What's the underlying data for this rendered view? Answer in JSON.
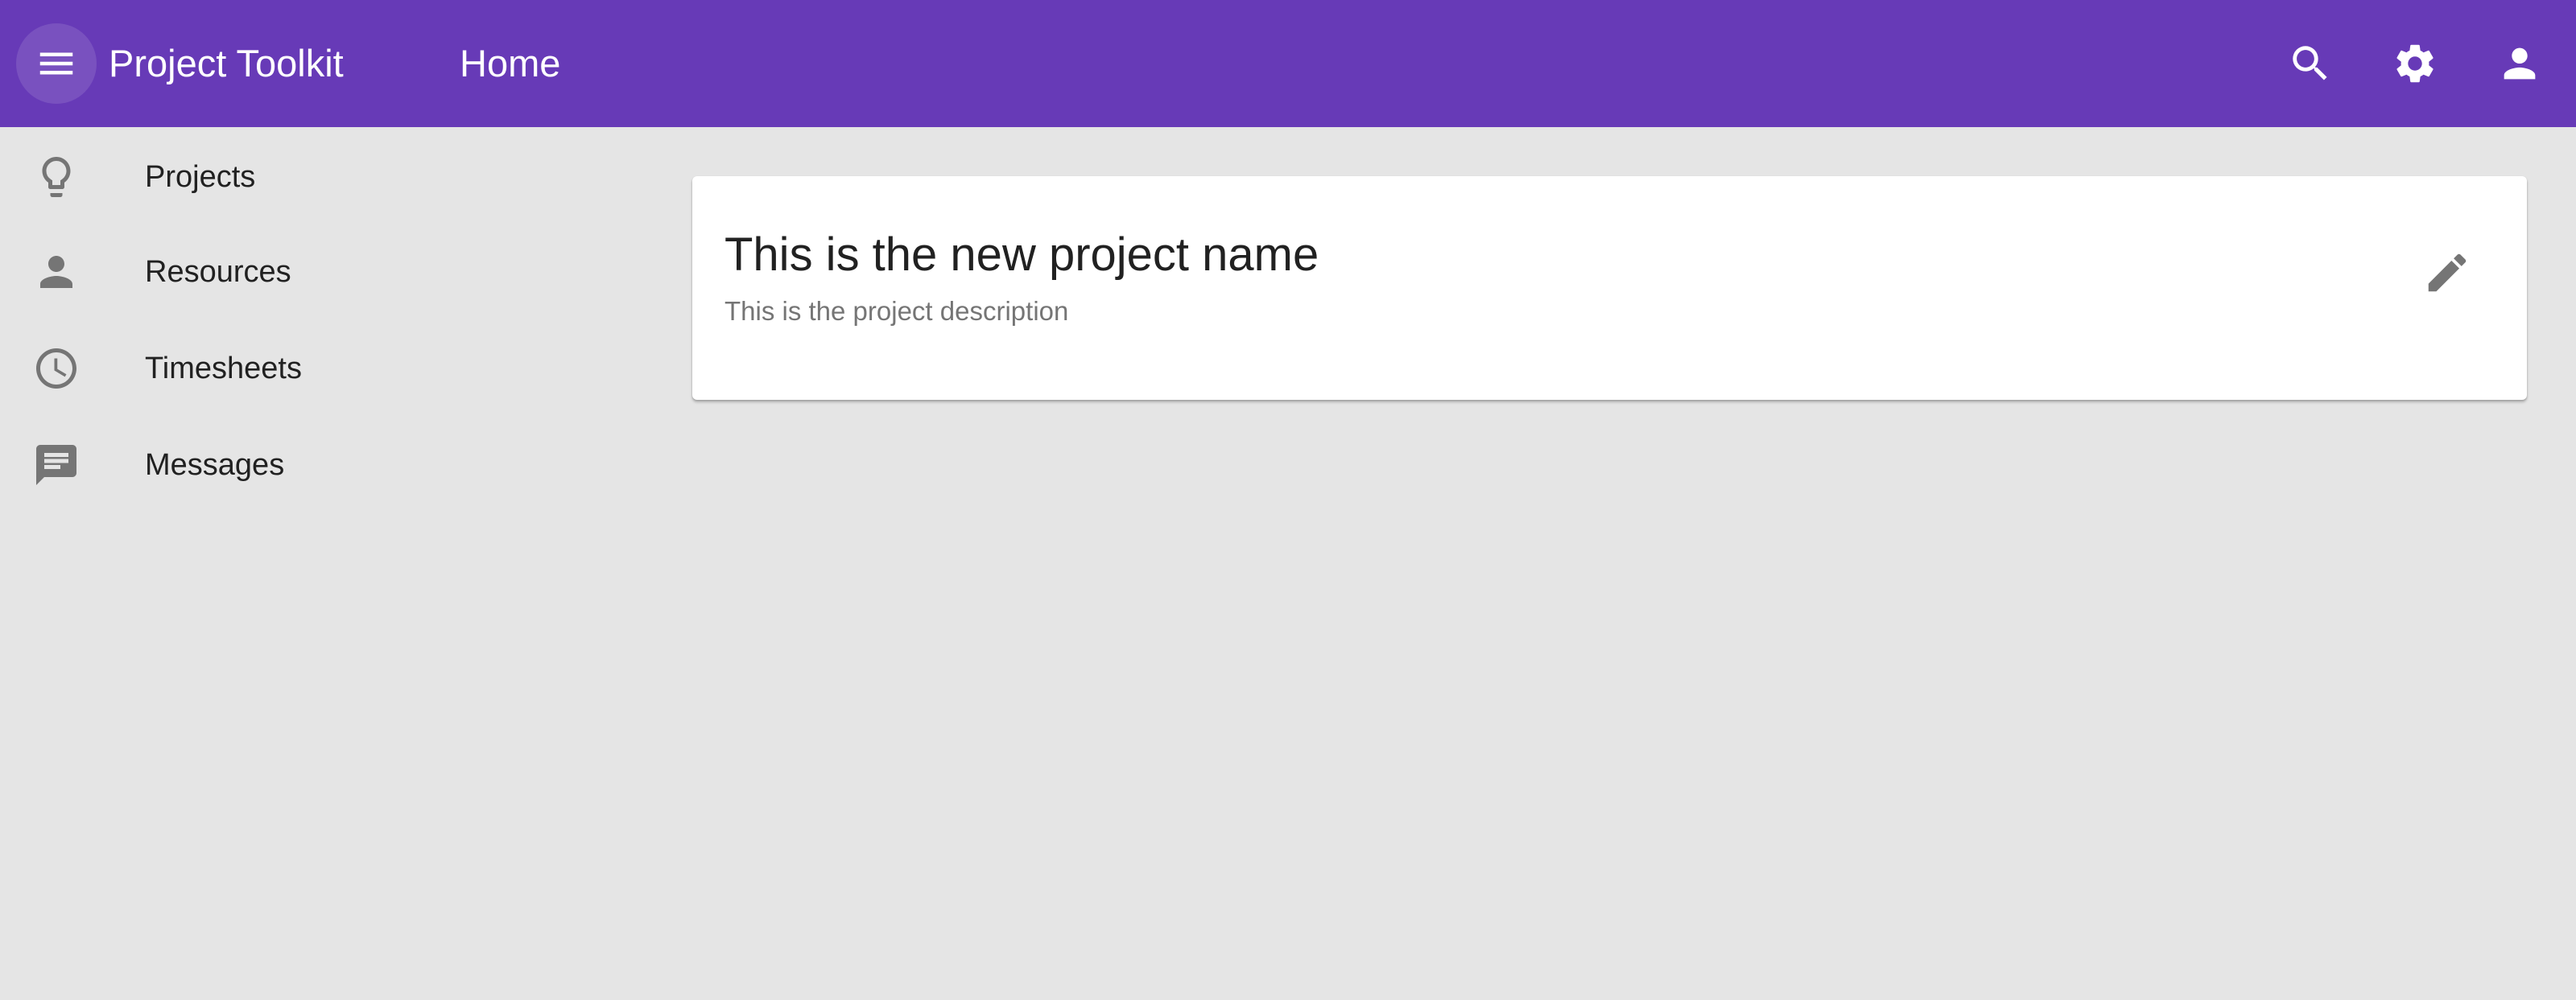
{
  "appbar": {
    "title": "Project Toolkit",
    "page_title": "Home",
    "background": "#673ab7",
    "icons": {
      "menu": "menu-icon",
      "search": "search-icon",
      "settings": "gear-icon",
      "account": "account-icon"
    }
  },
  "sidebar": {
    "items": [
      {
        "label": "Projects",
        "icon": "lightbulb-icon"
      },
      {
        "label": "Resources",
        "icon": "person-icon"
      },
      {
        "label": "Timesheets",
        "icon": "clock-icon"
      },
      {
        "label": "Messages",
        "icon": "message-icon"
      }
    ]
  },
  "card": {
    "title": "This is the new project name",
    "description": "This is the project description",
    "edit_icon": "pencil-icon"
  },
  "colors": {
    "background": "#e5e5e5",
    "card": "#ffffff",
    "icon": "#757575",
    "text_primary": "#212121",
    "text_secondary": "#757575"
  }
}
